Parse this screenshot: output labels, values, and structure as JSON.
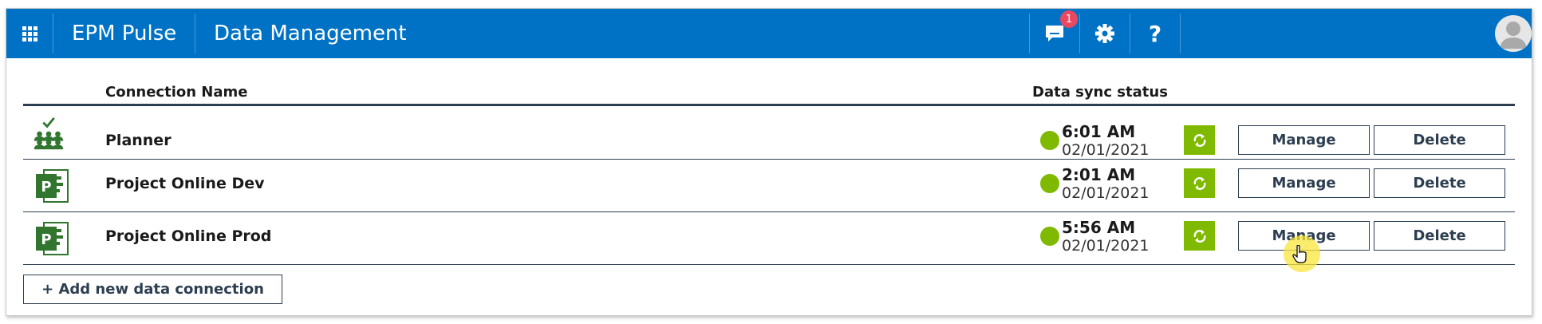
{
  "header": {
    "app_title": "EPM Pulse",
    "page_title": "Data Management",
    "notification_count": "1",
    "help_label": "?",
    "color": "#0072c6",
    "icons": [
      "waffle-icon",
      "chat-icon",
      "gear-icon",
      "help-icon",
      "user-avatar-icon"
    ]
  },
  "table": {
    "columns": {
      "connection_name": "Connection Name",
      "sync_status": "Data sync status"
    },
    "rows": [
      {
        "name": "Planner",
        "time": "6:01 AM",
        "date": "02/01/2021",
        "icon": "planner-icon",
        "manage": "Manage",
        "delete": "Delete"
      },
      {
        "name": "Project Online Dev",
        "time": "2:01 AM",
        "date": "02/01/2021",
        "icon": "project-online-icon",
        "manage": "Manage",
        "delete": "Delete"
      },
      {
        "name": "Project Online Prod",
        "time": "5:56 AM",
        "date": "02/01/2021",
        "icon": "project-online-icon",
        "manage": "Manage",
        "delete": "Delete"
      }
    ],
    "status_color": "#7fba00"
  },
  "footer": {
    "add_connection_label": "+ Add new data connection"
  }
}
